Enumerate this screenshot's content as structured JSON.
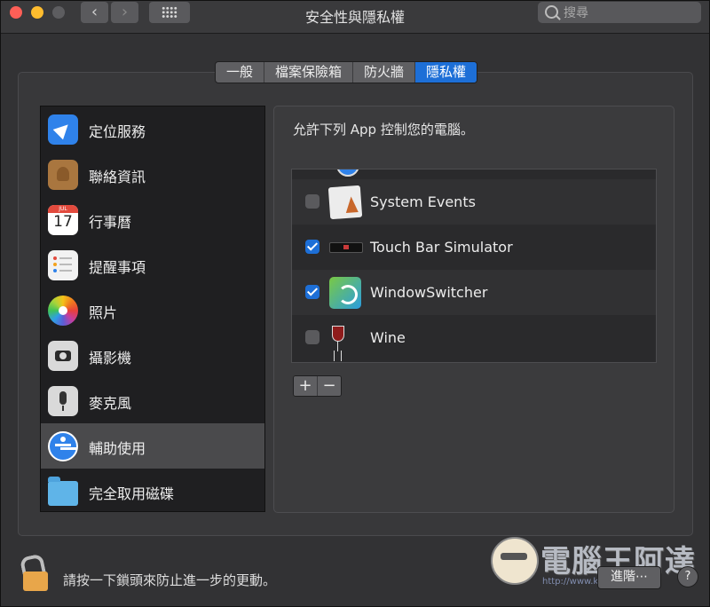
{
  "window": {
    "title": "安全性與隱私權",
    "search_placeholder": "搜尋"
  },
  "tabs": [
    {
      "label": "一般",
      "active": false
    },
    {
      "label": "檔案保險箱",
      "active": false
    },
    {
      "label": "防火牆",
      "active": false
    },
    {
      "label": "隱私權",
      "active": true
    }
  ],
  "sidebar": {
    "items": [
      {
        "label": "定位服務",
        "icon": "location-arrow-icon"
      },
      {
        "label": "聯絡資訊",
        "icon": "contacts-book-icon"
      },
      {
        "label": "行事曆",
        "icon": "calendar-icon",
        "calendar_day": "17",
        "calendar_month": "JUL"
      },
      {
        "label": "提醒事項",
        "icon": "reminders-list-icon"
      },
      {
        "label": "照片",
        "icon": "photos-flower-icon"
      },
      {
        "label": "攝影機",
        "icon": "camera-icon"
      },
      {
        "label": "麥克風",
        "icon": "microphone-icon"
      },
      {
        "label": "輔助使用",
        "icon": "accessibility-icon",
        "selected": true
      },
      {
        "label": "完全取用磁碟",
        "icon": "folder-icon"
      }
    ]
  },
  "main": {
    "heading": "允許下列 App 控制您的電腦。",
    "apps": [
      {
        "name": "System Events",
        "checked": false,
        "icon": "system-events-icon"
      },
      {
        "name": "Touch Bar Simulator",
        "checked": true,
        "icon": "touch-bar-icon"
      },
      {
        "name": "WindowSwitcher",
        "checked": true,
        "icon": "window-switcher-icon"
      },
      {
        "name": "Wine",
        "checked": false,
        "icon": "wine-glass-icon"
      }
    ],
    "add_label": "+",
    "remove_label": "−"
  },
  "footer": {
    "lock_text": "請按一下鎖頭來防止進一步的更動。",
    "advanced_label": "進階⋯",
    "help_label": "?"
  },
  "watermark": {
    "text": "電腦王阿達",
    "url": "http://www.koc.com.tw"
  },
  "colors": {
    "accent": "#1d6fd7",
    "window_bg": "#323234",
    "sidebar_bg": "#1f1f21"
  }
}
